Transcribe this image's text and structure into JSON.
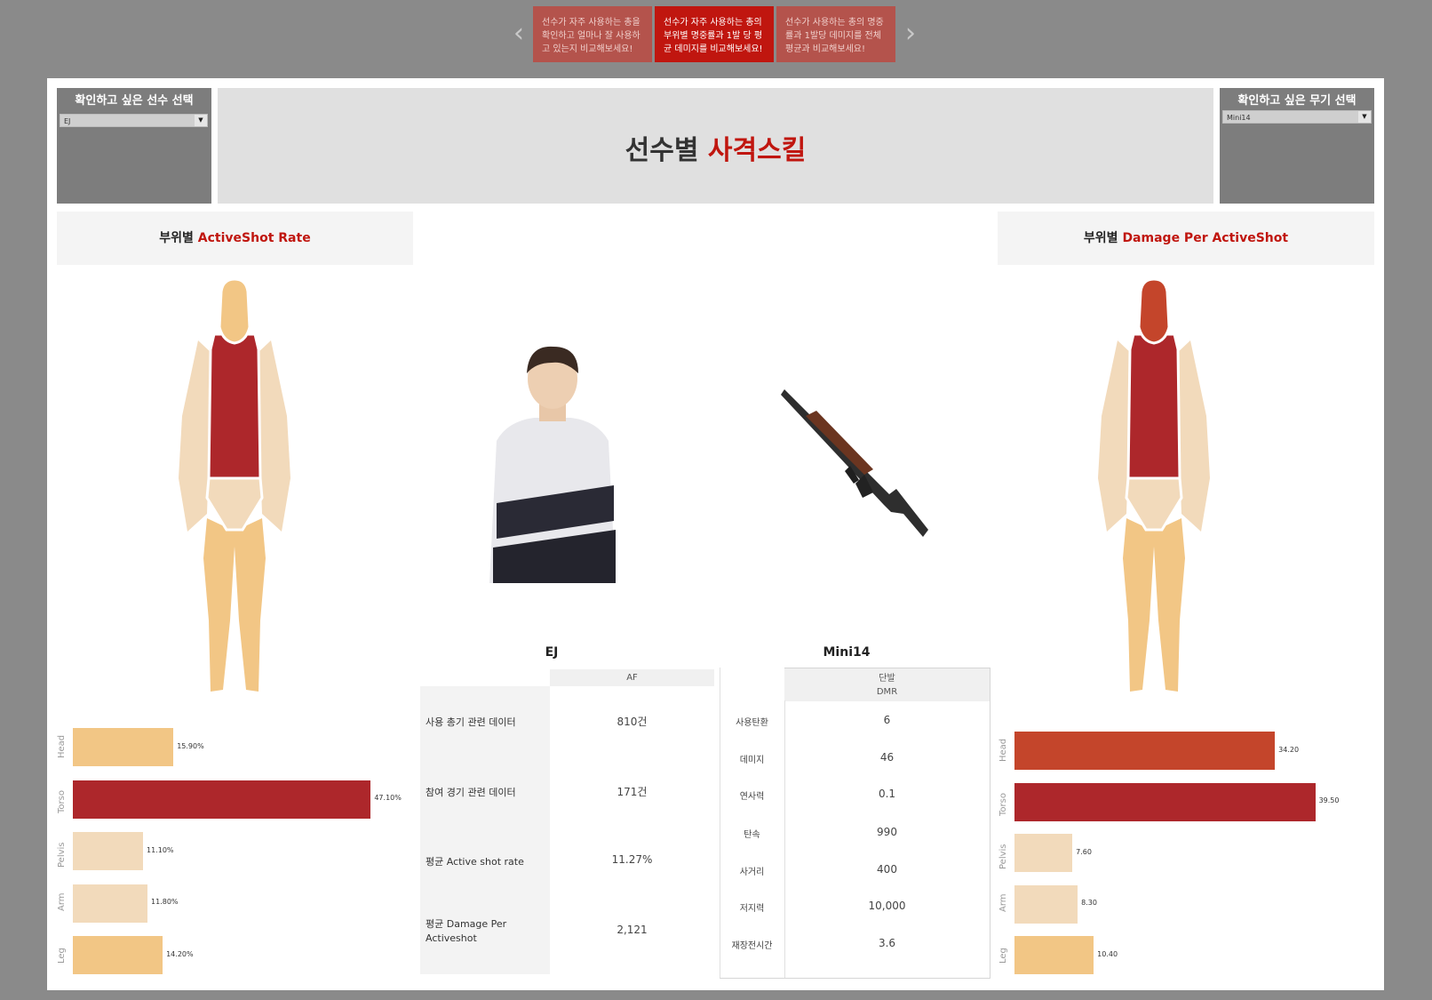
{
  "story": {
    "tabs": [
      {
        "label": "선수가 자주 사용하는 총을 확인하고 얼마나 잘 사용하고 있는지 비교해보세요!"
      },
      {
        "label": "선수가 자주 사용하는 총의 부위별 명중률과 1발 당 평균 데미지를 비교해보세요!"
      },
      {
        "label": "선수가 사용하는 총의 명중률과 1발당 데미지를 전체 평균과 비교해보세요!"
      }
    ],
    "prev_icon": "chevron-left-icon",
    "next_icon": "chevron-right-icon"
  },
  "filters": {
    "player": {
      "title": "확인하고 싶은 선수 선택",
      "value": "EJ"
    },
    "weapon": {
      "title": "확인하고 싶은 무기 선택",
      "value": "Mini14"
    }
  },
  "title": {
    "prefix": "선수별 ",
    "highlight": "사격스킬"
  },
  "left_section": {
    "prefix": "부위별 ",
    "highlight": "ActiveShot Rate"
  },
  "right_section": {
    "prefix": "부위별 ",
    "highlight": "Damage Per ActiveShot"
  },
  "colors": {
    "head_rate": "#f2c685",
    "torso": "#ad272b",
    "pelvis": "#f2dabb",
    "arm": "#f2dabb",
    "leg": "#f2c685",
    "head_dmg": "#c4452b",
    "accent": "#c0160f"
  },
  "chart_data": [
    {
      "type": "bar",
      "orientation": "horizontal",
      "categories": [
        "Head",
        "Torso",
        "Pelvis",
        "Arm",
        "Leg"
      ],
      "values": [
        15.9,
        47.1,
        11.1,
        11.8,
        14.2
      ],
      "labels": [
        "15.90%",
        "47.10%",
        "11.10%",
        "11.80%",
        "14.20%"
      ],
      "xlim": [
        0,
        50
      ]
    },
    {
      "type": "bar",
      "orientation": "horizontal",
      "categories": [
        "Head",
        "Torso",
        "Pelvis",
        "Arm",
        "Leg"
      ],
      "values": [
        34.2,
        39.5,
        7.6,
        8.3,
        10.4
      ],
      "labels": [
        "34.20",
        "39.50",
        "7.60",
        "8.30",
        "10.40"
      ],
      "xlim": [
        0,
        42
      ]
    }
  ],
  "player_table": {
    "name": "EJ",
    "column": "AF",
    "rows": [
      {
        "label": "사용 총기 관련 데이터",
        "value": "810건"
      },
      {
        "label": "참여 경기 관련 데이터",
        "value": "171건"
      },
      {
        "label": "평균 Active shot rate",
        "value": "11.27%"
      },
      {
        "label": "평균 Damage Per Activeshot",
        "value": "2,121"
      }
    ]
  },
  "weapon_table": {
    "name": "Mini14",
    "header1": "단발",
    "header2": "DMR",
    "rows": [
      {
        "label": "사용탄환",
        "value": "6"
      },
      {
        "label": "데미지",
        "value": "46"
      },
      {
        "label": "연사력",
        "value": "0.1"
      },
      {
        "label": "탄속",
        "value": "990"
      },
      {
        "label": "사거리",
        "value": "400"
      },
      {
        "label": "저지력",
        "value": "10,000"
      },
      {
        "label": "재장전시간",
        "value": "3.6"
      }
    ]
  }
}
